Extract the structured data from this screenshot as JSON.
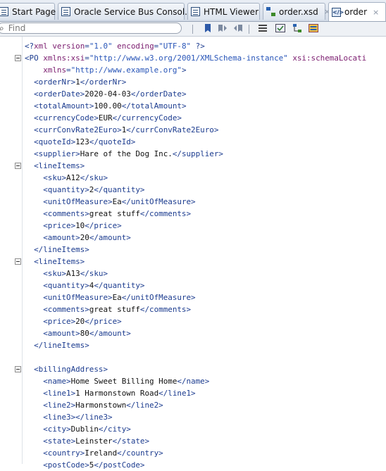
{
  "tabs": [
    {
      "label": "Start Page",
      "icon": "page-icon"
    },
    {
      "label": "Oracle Service Bus Consol...",
      "icon": "page-icon"
    },
    {
      "label": "HTML Viewer",
      "icon": "page-icon"
    },
    {
      "label": "order.xsd",
      "icon": "xsd-icon"
    },
    {
      "label": "order",
      "icon": "xml-icon",
      "active": true
    }
  ],
  "tab_close_glyph": "×",
  "search": {
    "placeholder": "Find"
  },
  "toolbar_buttons": [
    "bookmark-icon",
    "prev-bookmark-icon",
    "next-bookmark-icon",
    "format-icon",
    "validate-icon",
    "schema-icon",
    "view-icon"
  ],
  "editor": {
    "lines": [
      [
        [
          "p",
          "<?"
        ],
        [
          "a",
          "xml "
        ],
        [
          "a",
          "version"
        ],
        [
          "p",
          "="
        ],
        [
          "v",
          "\"1.0\""
        ],
        [
          "a",
          " encoding"
        ],
        [
          "p",
          "="
        ],
        [
          "v",
          "\"UTF-8\""
        ],
        [
          "p",
          " ?>"
        ]
      ],
      [
        [
          "t",
          "<PO "
        ],
        [
          "a",
          "xmlns:xsi"
        ],
        [
          "p",
          "="
        ],
        [
          "v",
          "\"http://www.w3.org/2001/XMLSchema-instance\""
        ],
        [
          "a",
          " xsi:schemaLocati"
        ]
      ],
      [
        [
          "a",
          "    xmlns"
        ],
        [
          "p",
          "="
        ],
        [
          "v",
          "\"http://www.example.org\""
        ],
        [
          "t",
          ">"
        ]
      ],
      [
        [
          "t",
          "  <orderNr>"
        ],
        [
          "tx",
          "1"
        ],
        [
          "t",
          "</orderNr>"
        ]
      ],
      [
        [
          "t",
          "  <orderDate>"
        ],
        [
          "tx",
          "2020-04-03"
        ],
        [
          "t",
          "</orderDate>"
        ]
      ],
      [
        [
          "t",
          "  <totalAmount>"
        ],
        [
          "tx",
          "100.00"
        ],
        [
          "t",
          "</totalAmount>"
        ]
      ],
      [
        [
          "t",
          "  <currencyCode>"
        ],
        [
          "tx",
          "EUR"
        ],
        [
          "t",
          "</currencyCode>"
        ]
      ],
      [
        [
          "t",
          "  <currConvRate2Euro>"
        ],
        [
          "tx",
          "1"
        ],
        [
          "t",
          "</currConvRate2Euro>"
        ]
      ],
      [
        [
          "t",
          "  <quoteId>"
        ],
        [
          "tx",
          "123"
        ],
        [
          "t",
          "</quoteId>"
        ]
      ],
      [
        [
          "t",
          "  <supplier>"
        ],
        [
          "tx",
          "Hare of the Dog Inc."
        ],
        [
          "t",
          "</supplier>"
        ]
      ],
      [
        [
          "t",
          "  <lineItems>"
        ]
      ],
      [
        [
          "t",
          "    <sku>"
        ],
        [
          "tx",
          "A12"
        ],
        [
          "t",
          "</sku>"
        ]
      ],
      [
        [
          "t",
          "    <quantity>"
        ],
        [
          "tx",
          "2"
        ],
        [
          "t",
          "</quantity>"
        ]
      ],
      [
        [
          "t",
          "    <unitOfMeasure>"
        ],
        [
          "tx",
          "Ea"
        ],
        [
          "t",
          "</unitOfMeasure>"
        ]
      ],
      [
        [
          "t",
          "    <comments>"
        ],
        [
          "tx",
          "great stuff"
        ],
        [
          "t",
          "</comments>"
        ]
      ],
      [
        [
          "t",
          "    <price>"
        ],
        [
          "tx",
          "10"
        ],
        [
          "t",
          "</price>"
        ]
      ],
      [
        [
          "t",
          "    <amount>"
        ],
        [
          "tx",
          "20"
        ],
        [
          "t",
          "</amount>"
        ]
      ],
      [
        [
          "t",
          "  </lineItems>"
        ]
      ],
      [
        [
          "t",
          "  <lineItems>"
        ]
      ],
      [
        [
          "t",
          "    <sku>"
        ],
        [
          "tx",
          "A13"
        ],
        [
          "t",
          "</sku>"
        ]
      ],
      [
        [
          "t",
          "    <quantity>"
        ],
        [
          "tx",
          "4"
        ],
        [
          "t",
          "</quantity>"
        ]
      ],
      [
        [
          "t",
          "    <unitOfMeasure>"
        ],
        [
          "tx",
          "Ea"
        ],
        [
          "t",
          "</unitOfMeasure>"
        ]
      ],
      [
        [
          "t",
          "    <comments>"
        ],
        [
          "tx",
          "great stuff"
        ],
        [
          "t",
          "</comments>"
        ]
      ],
      [
        [
          "t",
          "    <price>"
        ],
        [
          "tx",
          "20"
        ],
        [
          "t",
          "</price>"
        ]
      ],
      [
        [
          "t",
          "    <amount>"
        ],
        [
          "tx",
          "80"
        ],
        [
          "t",
          "</amount>"
        ]
      ],
      [
        [
          "t",
          "  </lineItems>"
        ]
      ],
      [],
      [
        [
          "t",
          "  <billingAddress>"
        ]
      ],
      [
        [
          "t",
          "    <name>"
        ],
        [
          "tx",
          "Home Sweet Billing Home"
        ],
        [
          "t",
          "</name>"
        ]
      ],
      [
        [
          "t",
          "    <line1>"
        ],
        [
          "tx",
          "1 Harmonstown Road"
        ],
        [
          "t",
          "</line1>"
        ]
      ],
      [
        [
          "t",
          "    <line2>"
        ],
        [
          "tx",
          "Harmonstown"
        ],
        [
          "t",
          "</line2>"
        ]
      ],
      [
        [
          "t",
          "    <line3>"
        ],
        [
          "t",
          "</line3>"
        ]
      ],
      [
        [
          "t",
          "    <city>"
        ],
        [
          "tx",
          "Dublin"
        ],
        [
          "t",
          "</city>"
        ]
      ],
      [
        [
          "t",
          "    <state>"
        ],
        [
          "tx",
          "Leinster"
        ],
        [
          "t",
          "</state>"
        ]
      ],
      [
        [
          "t",
          "    <country>"
        ],
        [
          "tx",
          "Ireland"
        ],
        [
          "t",
          "</country>"
        ]
      ],
      [
        [
          "t",
          "    <postCode>"
        ],
        [
          "tx",
          "5"
        ],
        [
          "t",
          "</postCode>"
        ]
      ]
    ],
    "fold_lines": [
      1,
      10,
      18,
      27
    ]
  }
}
